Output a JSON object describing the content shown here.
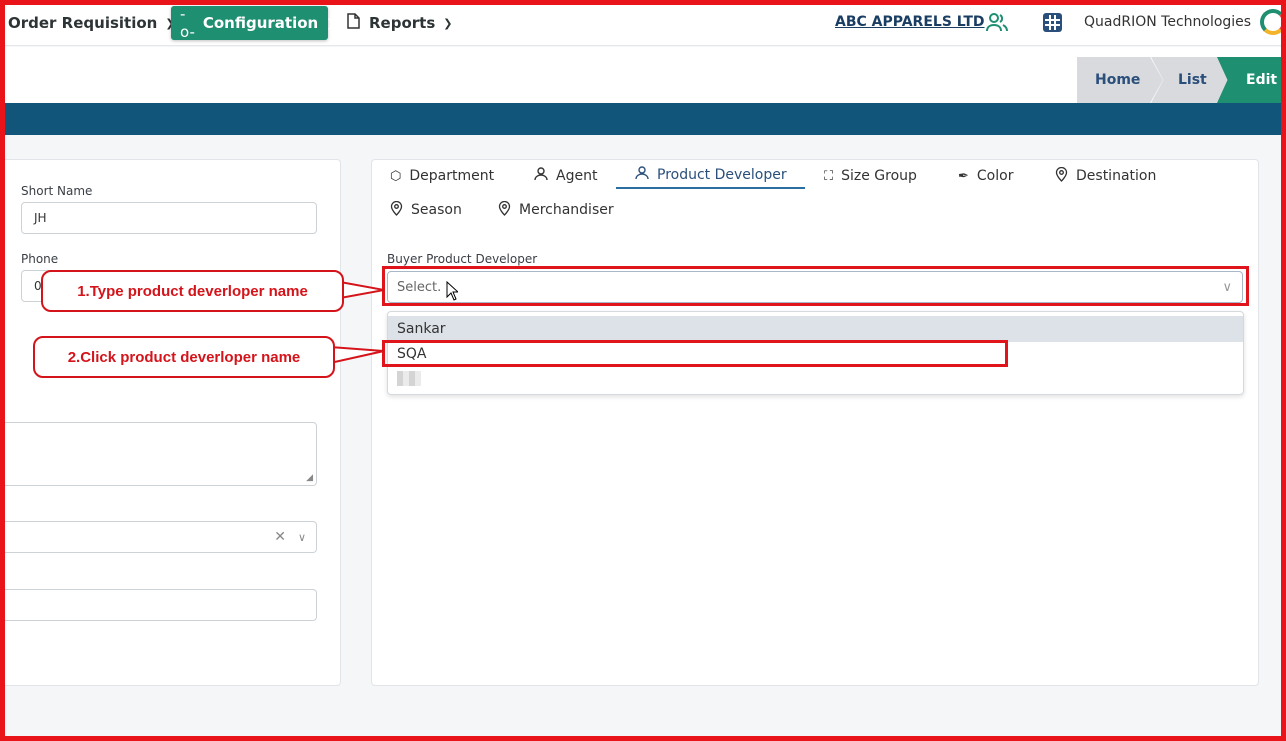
{
  "nav": {
    "order_requisition": "Order Requisition",
    "configuration": "Configuration",
    "reports": "Reports",
    "company": "ABC APPARELS LTD",
    "organization": "QuadRION Technologies"
  },
  "breadcrumb": {
    "home": "Home",
    "list": "List",
    "edit": "Edit"
  },
  "left_form": {
    "short_name_label": "Short Name",
    "short_name_value": "JH",
    "phone_label": "Phone",
    "phone_value": "0"
  },
  "tabs": [
    {
      "label": "Department",
      "icon": "cube-icon"
    },
    {
      "label": "Agent",
      "icon": "user-icon"
    },
    {
      "label": "Product Developer",
      "icon": "user-icon",
      "active": true
    },
    {
      "label": "Size Group",
      "icon": "expand-icon"
    },
    {
      "label": "Color",
      "icon": "feather-icon"
    },
    {
      "label": "Destination",
      "icon": "map-pin-icon"
    },
    {
      "label": "Season",
      "icon": "map-pin-icon"
    },
    {
      "label": "Merchandiser",
      "icon": "map-pin-icon"
    }
  ],
  "buyer_product_developer": {
    "label": "Buyer Product Developer",
    "placeholder": "Select.",
    "options": [
      "Sankar",
      "SQA"
    ]
  },
  "annotations": {
    "step1": "1.Type product deverloper name",
    "step2": "2.Click product deverloper name"
  },
  "colors": {
    "accent_green": "#1f8f72",
    "header_blue": "#11567a",
    "annotation_red": "#e0141b"
  }
}
